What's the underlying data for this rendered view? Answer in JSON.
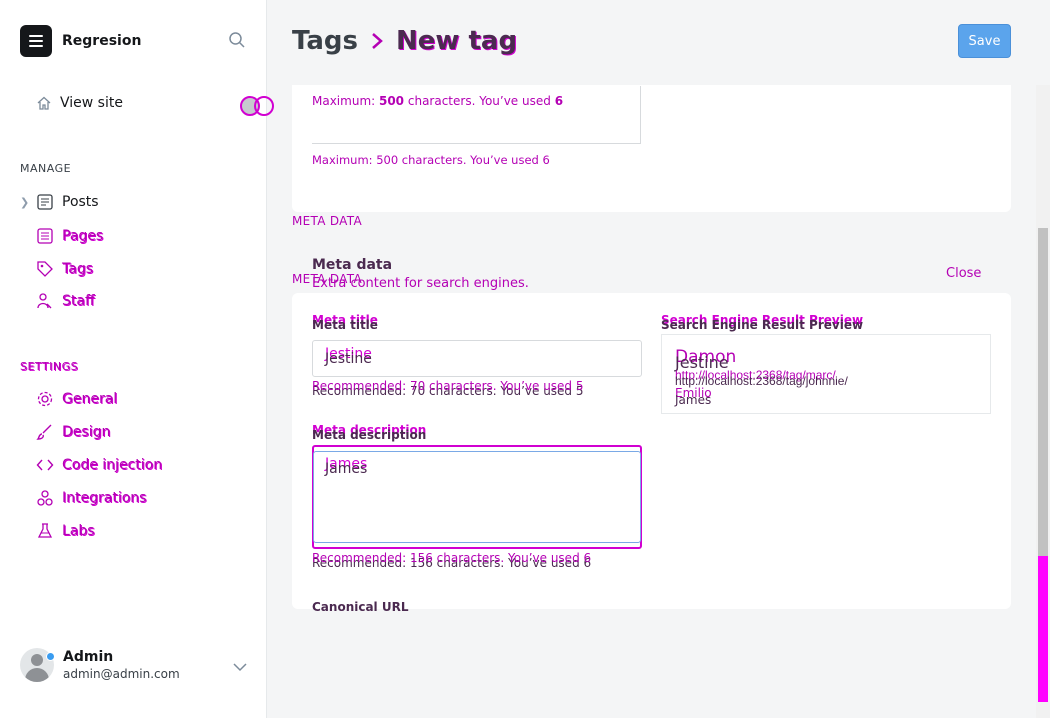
{
  "sidebar": {
    "brand": "Regresion",
    "view_site": "View site",
    "manage_label": "MANAGE",
    "manage_items": [
      {
        "label": "Posts",
        "icon": "posts-icon"
      },
      {
        "label": "Pages",
        "icon": "pages-icon"
      },
      {
        "label": "Tags",
        "icon": "tag-icon"
      },
      {
        "label": "Staff",
        "icon": "staff-icon"
      }
    ],
    "settings_label": "SETTINGS",
    "settings_items": [
      {
        "label": "General",
        "icon": "gear-icon"
      },
      {
        "label": "Design",
        "icon": "brush-icon"
      },
      {
        "label": "Code injection",
        "icon": "code-icon"
      },
      {
        "label": "Integrations",
        "icon": "integrations-icon"
      },
      {
        "label": "Labs",
        "icon": "flask-icon"
      }
    ],
    "user": {
      "name": "Admin",
      "email": "admin@admin.com"
    }
  },
  "header": {
    "crumb_parent": "Tags",
    "crumb_current": "New tag",
    "save_label": "Save"
  },
  "top_card": {
    "hint1_prefix": "Maximum: ",
    "hint1_num": "500",
    "hint1_mid": " characters. You’ve used ",
    "hint1_used": "6",
    "hint2": "Maximum: 500 characters. You’ve used 6"
  },
  "meta": {
    "section_caps": "META DATA",
    "section_caps_ghost": "META DATA",
    "title": "Meta data",
    "subtitle": "Extra content for search engines.",
    "close_label": "Close",
    "meta_title_label": "Meta Title",
    "meta_title_label_alt": "Meta title",
    "meta_title_value": "Jestine",
    "meta_title_value_ghost": "Damon",
    "meta_title_hint": "Recommended: 70 characters. You’ve used 7",
    "meta_title_hint_ghost": "Recommended: 70 characters. You’ve used 5",
    "meta_desc_label": "Meta Description",
    "meta_desc_label_alt": "Meta description",
    "meta_desc_value": "James",
    "meta_desc_value_ghost": "Emilio",
    "meta_desc_hint": "Recommended: 156 characters. You’ve used 5",
    "meta_desc_hint_ghost": "Recommended: 156 characters. You’ve used 6",
    "preview_label": "Search Engine Result Preview",
    "preview_title": "Jestine",
    "preview_title_ghost": "Damon",
    "preview_url": "http://localhost:2368/tag/johnnie/",
    "preview_url_ghost": "http://localhost:2368/tag/marc/",
    "preview_desc": "James",
    "preview_desc_ghost": "Emilio",
    "canonical_label": "Canonical URL"
  }
}
